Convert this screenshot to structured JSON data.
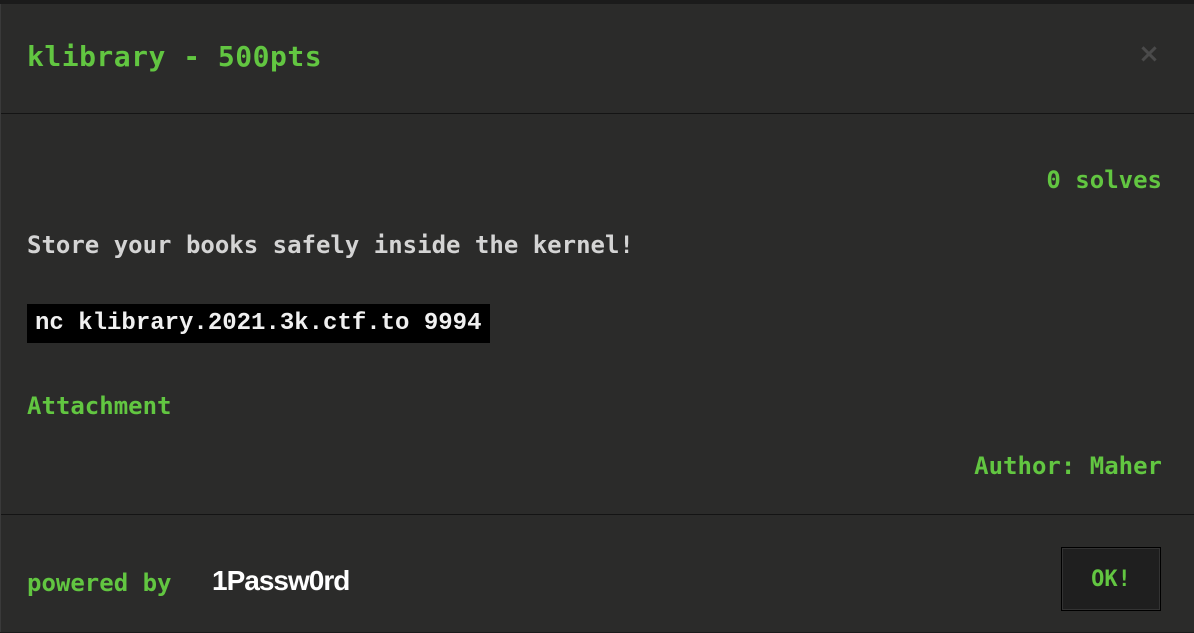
{
  "modal": {
    "title": "klibrary - 500pts",
    "close_glyph": "×",
    "solves": "0 solves",
    "description": "Store your books safely inside the kernel!",
    "command": "nc klibrary.2021.3k.ctf.to 9994",
    "attachment_label": "Attachment",
    "author": "Author: Maher"
  },
  "footer": {
    "powered_by": "powered by",
    "brand": "1Passw0rd",
    "ok_label": "OK!"
  },
  "colors": {
    "accent": "#62c641",
    "panel": "#2b2b2a",
    "code_bg": "#000000",
    "text": "#d4d4d4"
  },
  "icons": {
    "close": "close-icon"
  }
}
